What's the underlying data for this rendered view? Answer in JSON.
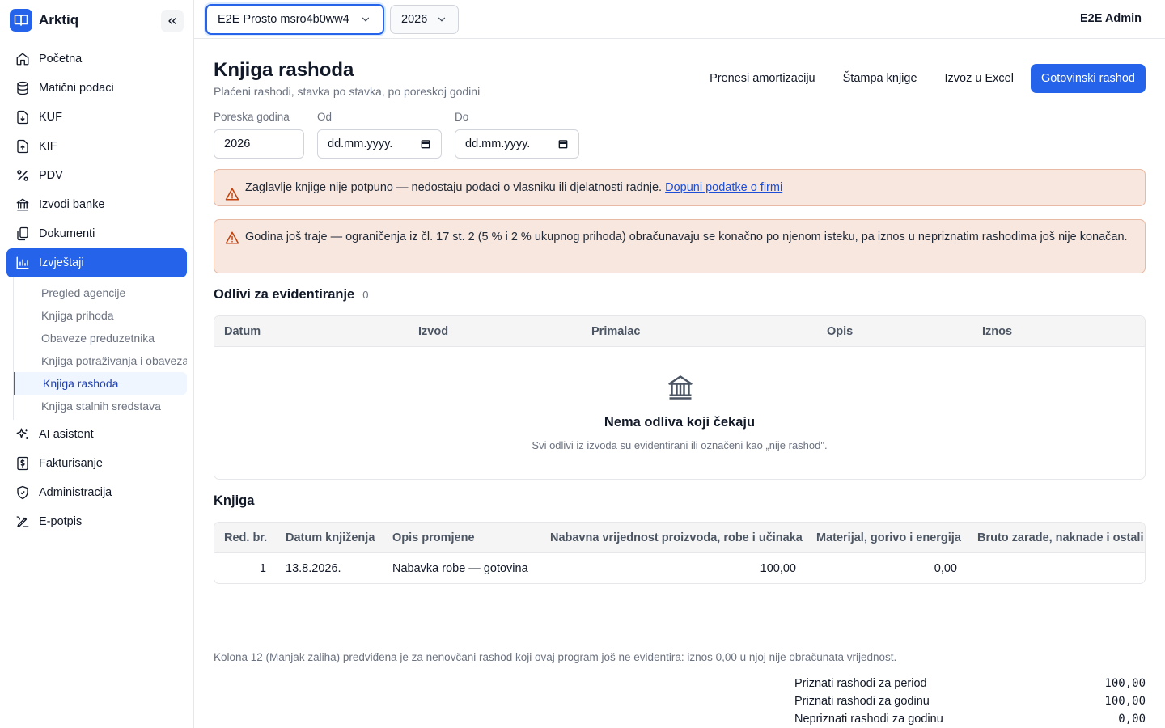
{
  "app": {
    "name": "Arktiq"
  },
  "sidebar": {
    "items": [
      {
        "label": "Početna",
        "icon": "home-icon"
      },
      {
        "label": "Matični podaci",
        "icon": "database-icon"
      },
      {
        "label": "KUF",
        "icon": "file-download-icon"
      },
      {
        "label": "KIF",
        "icon": "file-upload-icon"
      },
      {
        "label": "PDV",
        "icon": "percent-icon"
      },
      {
        "label": "Izvodi banke",
        "icon": "bank-icon"
      },
      {
        "label": "Dokumenti",
        "icon": "documents-icon"
      },
      {
        "label": "Izvještaji",
        "icon": "chart-icon"
      }
    ],
    "sub_items": [
      {
        "label": "Pregled agencije"
      },
      {
        "label": "Knjiga prihoda"
      },
      {
        "label": "Obaveze preduzetnika"
      },
      {
        "label": "Knjiga potraživanja i obaveza"
      },
      {
        "label": "Knjiga rashoda"
      },
      {
        "label": "Knjiga stalnih sredstava"
      }
    ],
    "items_after": [
      {
        "label": "AI asistent",
        "icon": "sparkles-icon"
      },
      {
        "label": "Fakturisanje",
        "icon": "invoice-icon"
      },
      {
        "label": "Administracija",
        "icon": "shield-icon"
      },
      {
        "label": "E-potpis",
        "icon": "signature-icon"
      }
    ]
  },
  "topbar": {
    "company": "E2E Prosto msro4b0ww4",
    "year": "2026",
    "user": "E2E Admin"
  },
  "page": {
    "title": "Knjiga rashoda",
    "subtitle": "Plaćeni rashodi, stavka po stavka, po poreskoj godini",
    "actions": {
      "transfer": "Prenesi amortizaciju",
      "print": "Štampa knjige",
      "export": "Izvoz u Excel",
      "cash": "Gotovinski rashod"
    }
  },
  "filters": {
    "year_label": "Poreska godina",
    "year_value": "2026",
    "from_label": "Od",
    "from_value": "dd.mm.yyyy.",
    "to_label": "Do",
    "to_value": "dd.mm.yyyy."
  },
  "alerts": {
    "header_text": "Zaglavlje knjige nije potpuno — nedostaju podaci o vlasniku ili djelatnosti radnje. ",
    "header_link": "Dopuni podatke o firmi",
    "year_text": "Godina još traje — ograničenja iz čl. 17 st. 2 (5 % i 2 % ukupnog prihoda) obračunavaju se konačno po njenom isteku, pa iznos u nepriznatim rashodima još nije konačan."
  },
  "outflows": {
    "title": "Odlivi za evidentiranje",
    "count": "0",
    "columns": [
      "Datum",
      "Izvod",
      "Primalac",
      "Opis",
      "Iznos"
    ],
    "empty_title": "Nema odliva koji čekaju",
    "empty_sub": "Svi odlivi iz izvoda su evidentirani ili označeni kao „nije rashod\"."
  },
  "book": {
    "title": "Knjiga",
    "columns": [
      "Red. br.",
      "Datum knjiženja",
      "Opis promjene",
      "Nabavna vrijednost proizvoda, robe i učinaka",
      "Materijal, gorivo i energija",
      "Bruto zarade, naknade i ostali lični rashodi"
    ],
    "rows": [
      {
        "no": "1",
        "date": "13.8.2026.",
        "desc": "Nabavka robe — gotovina",
        "purchase": "100,00",
        "material": "0,00"
      }
    ]
  },
  "footer": {
    "note": "Kolona 12 (Manjak zaliha) predviđena je za nenovčani rashod koji ovaj program još ne evidentira: iznos 0,00 u njoj nije obračunata vrijednost.",
    "totals": [
      {
        "label": "Priznati rashodi za period",
        "value": "100,00"
      },
      {
        "label": "Priznati rashodi za godinu",
        "value": "100,00"
      },
      {
        "label": "Nepriznati rashodi za godinu",
        "value": "0,00"
      }
    ]
  }
}
